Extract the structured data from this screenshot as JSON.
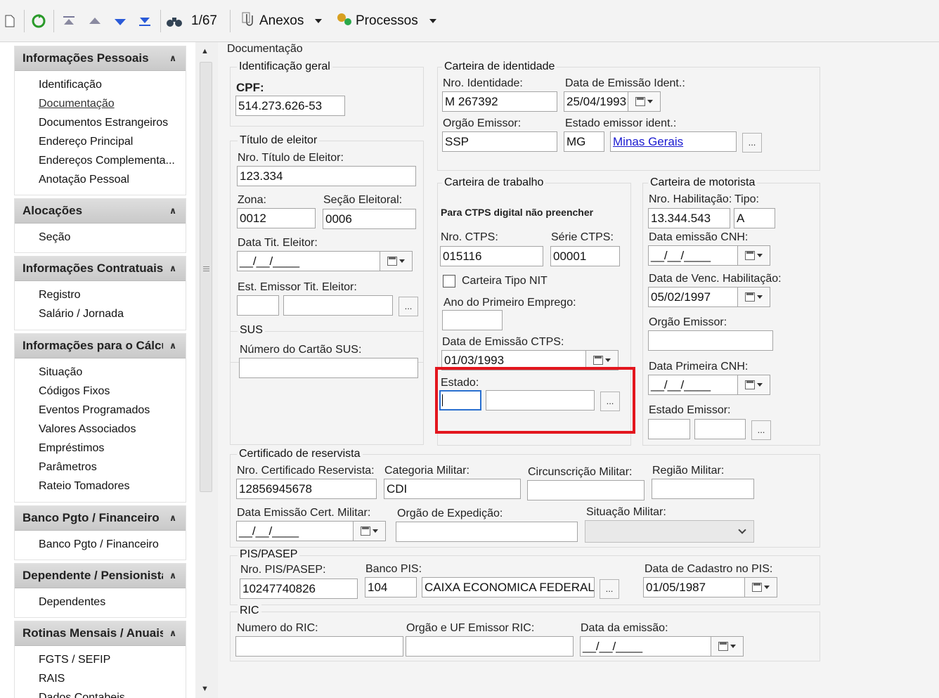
{
  "toolbar": {
    "record_counter": "1/67",
    "attachments": "Anexos",
    "processes": "Processos"
  },
  "sidebar": {
    "sections": [
      {
        "title": "Informações Pessoais",
        "items": [
          "Identificação",
          "Documentação",
          "Documentos Estrangeiros",
          "Endereço Principal",
          "Endereços Complementa...",
          "Anotação Pessoal"
        ]
      },
      {
        "title": "Alocações",
        "items": [
          "Seção"
        ]
      },
      {
        "title": "Informações Contratuais",
        "items": [
          "Registro",
          "Salário / Jornada"
        ]
      },
      {
        "title": "Informações para o Cálculo",
        "items": [
          "Situação",
          "Códigos Fixos",
          "Eventos Programados",
          "Valores Associados",
          "Empréstimos",
          "Parâmetros",
          "Rateio Tomadores"
        ]
      },
      {
        "title": "Banco Pgto / Financeiro",
        "items": [
          "Banco Pgto / Financeiro"
        ]
      },
      {
        "title": "Dependente / Pensionista",
        "items": [
          "Dependentes"
        ]
      },
      {
        "title": "Rotinas Mensais / Anuais",
        "items": [
          "FGTS / SEFIP",
          "RAIS",
          "Dados Contabeis"
        ]
      }
    ]
  },
  "form": {
    "page_title": "Documentação",
    "ident_geral": {
      "legend": "Identificação geral",
      "cpf_label": "CPF:",
      "cpf": "514.273.626-53"
    },
    "titulo_eleitor": {
      "legend": "Título de eleitor",
      "nro_label": "Nro. Título de Eleitor:",
      "nro": "123.334",
      "zona_label": "Zona:",
      "zona": "0012",
      "secao_label": "Seção Eleitoral:",
      "secao": "0006",
      "data_label": "Data Tit. Eleitor:",
      "data": "__/__/____",
      "est_label": "Est. Emissor Tit. Eleitor:",
      "est_code": "",
      "est_name": ""
    },
    "sus": {
      "legend": "SUS",
      "num_label": "Número do Cartão SUS:",
      "num": ""
    },
    "rg": {
      "legend": "Carteira de identidade",
      "nro_label": "Nro. Identidade:",
      "nro": "M 267392",
      "data_label": "Data de Emissão Ident.:",
      "data": "25/04/1993",
      "orgao_label": "Orgão Emissor:",
      "orgao": "SSP",
      "estado_label": "Estado emissor ident.:",
      "estado_uf": "MG",
      "estado_nome": "Minas Gerais"
    },
    "ctps": {
      "legend": "Carteira de trabalho",
      "note": "Para CTPS digital não preencher",
      "nro_label": "Nro. CTPS:",
      "nro": "015116",
      "serie_label": "Série CTPS:",
      "serie": "00001",
      "nit_label": "Carteira Tipo NIT",
      "ano_label": "Ano do Primeiro Emprego:",
      "ano": "",
      "data_label": "Data de Emissão CTPS:",
      "data": "01/03/1993",
      "estado_label": "Estado:",
      "estado_uf": "",
      "estado_nome": ""
    },
    "cnh": {
      "legend": "Carteira de motorista",
      "nro_label": "Nro. Habilitação:",
      "nro": "13.344.543",
      "tipo_label": "Tipo:",
      "tipo": "A",
      "emissao_label": "Data emissão CNH:",
      "emissao": "__/__/____",
      "venc_label": "Data de Venc. Habilitação:",
      "venc": "05/02/1997",
      "orgao_label": "Orgão Emissor:",
      "orgao": "",
      "primeira_label": "Data Primeira CNH:",
      "primeira": "__/__/____",
      "estado_label": "Estado Emissor:",
      "estado_uf": "",
      "estado_nome": ""
    },
    "reservista": {
      "legend": "Certificado de reservista",
      "nro_label": "Nro. Certificado Reservista:",
      "nro": "12856945678",
      "cat_label": "Categoria Militar:",
      "cat": "CDI",
      "circ_label": "Circunscrição Militar:",
      "circ": "",
      "regiao_label": "Região Militar:",
      "regiao": "",
      "data_label": "Data Emissão Cert. Militar:",
      "data": "__/__/____",
      "orgao_label": "Orgão de Expedição:",
      "orgao": "",
      "sit_label": "Situação Militar:",
      "sit": ""
    },
    "pis": {
      "legend": "PIS/PASEP",
      "nro_label": "Nro. PIS/PASEP:",
      "nro": "10247740826",
      "banco_label": "Banco PIS:",
      "banco_cod": "104",
      "banco_nome": "CAIXA ECONOMICA FEDERAL",
      "cad_label": "Data de Cadastro no PIS:",
      "cad": "01/05/1987"
    },
    "ric": {
      "legend": "RIC",
      "num_label": "Numero do RIC:",
      "num": "",
      "orgao_label": "Orgão e UF Emissor RIC:",
      "orgao": "",
      "data_label": "Data da emissão:",
      "data": "__/__/____"
    }
  }
}
